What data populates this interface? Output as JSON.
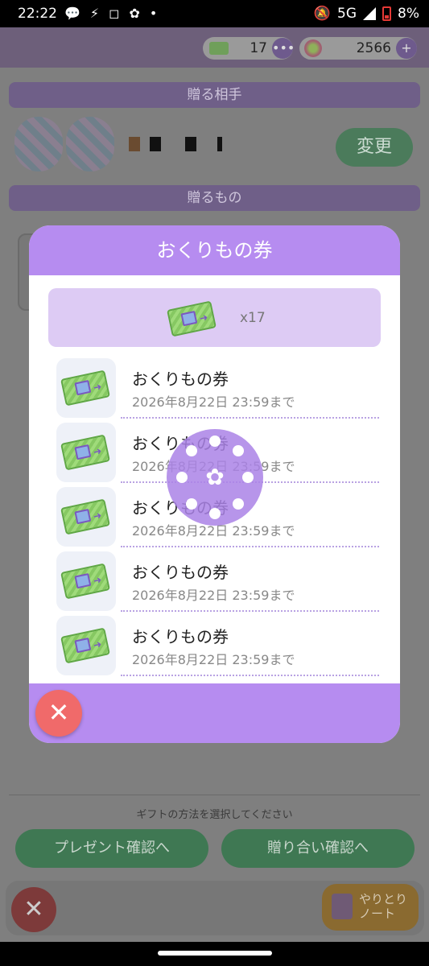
{
  "status_bar": {
    "time": "22:22",
    "network": "5G",
    "battery": "8%"
  },
  "currencies": {
    "tickets": "17",
    "clover": "2566",
    "more_label": "•••",
    "add_label": "+"
  },
  "background": {
    "recipient_header": "贈る相手",
    "gift_header": "贈るもの",
    "change_button": "変更",
    "hint": "ギフトの方法を選択してください",
    "present_button": "プレゼント確認へ",
    "exchange_button": "贈り合い確認へ",
    "note_button_line1": "やりとり",
    "note_button_line2": "ノート",
    "close_label": "✕"
  },
  "modal": {
    "title": "おくりもの券",
    "summary_qty": "x17",
    "items": [
      {
        "name": "おくりもの券",
        "expiry": "2026年8月22日  23:59まで"
      },
      {
        "name": "おくりもの券",
        "expiry": "2026年8月22日  23:59まで"
      },
      {
        "name": "おくりもの券",
        "expiry": "2026年8月22日  23:59まで"
      },
      {
        "name": "おくりもの券",
        "expiry": "2026年8月22日  23:59まで"
      },
      {
        "name": "おくりもの券",
        "expiry": "2026年8月22日  23:59まで"
      }
    ],
    "close_label": "✕"
  },
  "colors": {
    "accent": "#b68cf0",
    "close": "#f06a6a",
    "ticket": "#9fdb7a"
  }
}
